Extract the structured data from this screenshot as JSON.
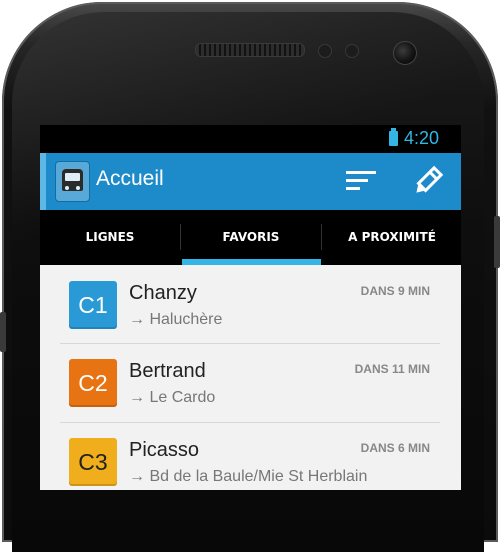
{
  "status_bar": {
    "time": "4:20",
    "battery_color": "#33b5e5"
  },
  "action_bar": {
    "title": "Accueil",
    "app_icon": "bus-icon",
    "actions": [
      {
        "name": "sort",
        "icon": "sort-icon"
      },
      {
        "name": "edit",
        "icon": "edit-icon"
      }
    ],
    "color": "#1d8bc9"
  },
  "tabs": [
    {
      "label": "LIGNES",
      "selected": false
    },
    {
      "label": "FAVORIS",
      "selected": true
    },
    {
      "label": "A PROXIMITÉ",
      "selected": false
    }
  ],
  "favorites": [
    {
      "line": "C1",
      "line_color": "#2a9ad6",
      "stop": "Chanzy",
      "destination": "→ Haluchère",
      "eta": "DANS 9 MIN"
    },
    {
      "line": "C2",
      "line_color": "#e87312",
      "stop": "Bertrand",
      "destination": "→ Le Cardo",
      "eta": "DANS 11 MIN"
    },
    {
      "line": "C3",
      "line_color": "#f0ad1c",
      "stop": "Picasso",
      "destination": "→ Bd de la Baule/Mie St Herblain",
      "eta": "DANS 6 MIN"
    }
  ]
}
